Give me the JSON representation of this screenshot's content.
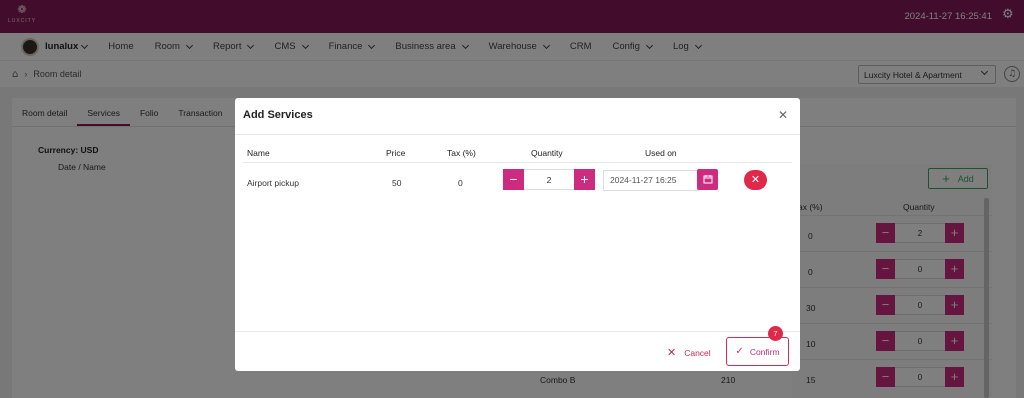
{
  "topbar": {
    "logo_text": "LUXCITY",
    "datetime": "2024-11-27 16:25:41",
    "accent": "#84195a"
  },
  "nav": {
    "username": "lunalux",
    "items": [
      "Home",
      "Room",
      "Report",
      "CMS",
      "Finance",
      "Business area",
      "Warehouse",
      "CRM",
      "Config",
      "Log"
    ]
  },
  "breadcrumb": {
    "current": "Room detail"
  },
  "hotel_select": {
    "value": "Luxcity Hotel & Apartment"
  },
  "page": {
    "tabs": [
      "Room detail",
      "Services",
      "Folio",
      "Transaction"
    ],
    "active_tab": "Services",
    "currency_label": "Currency: USD",
    "date_name_header": "Date / Name",
    "add_label": "Add",
    "columns": {
      "tax": "ax (%)",
      "quantity": "Quantity"
    },
    "rows": [
      {
        "name": "",
        "price": "",
        "tax": "0",
        "quantity": "2"
      },
      {
        "name": "",
        "price": "",
        "tax": "0",
        "quantity": "0"
      },
      {
        "name": "",
        "price": "",
        "tax": "30",
        "quantity": "0"
      },
      {
        "name": "",
        "price": "",
        "tax": "10",
        "quantity": "0"
      },
      {
        "name": "Combo B",
        "price": "210",
        "tax": "15",
        "quantity": "0"
      }
    ]
  },
  "modal": {
    "title": "Add Services",
    "columns": {
      "name": "Name",
      "price": "Price",
      "tax": "Tax (%)",
      "quantity": "Quantity",
      "used_on": "Used on"
    },
    "row": {
      "name": "Airport pickup",
      "price": "50",
      "tax": "0",
      "quantity": "2",
      "used_on": "2024-11-27 16:25"
    },
    "cancel_label": "Cancel",
    "confirm_label": "Confirm",
    "step_badge": "7"
  },
  "colors": {
    "primary": "#cc2b80",
    "danger": "#e0294a",
    "success": "#3aa55d"
  }
}
